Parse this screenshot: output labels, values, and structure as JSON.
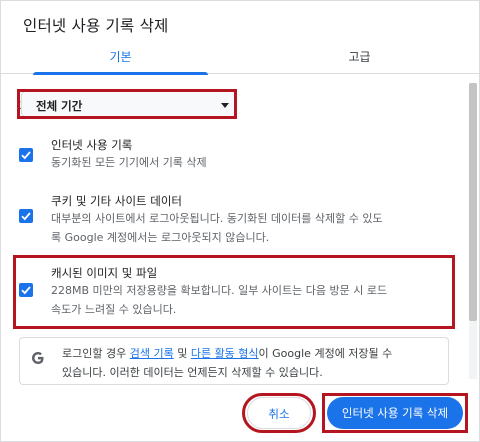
{
  "dialog": {
    "title": "인터넷 사용 기록 삭제"
  },
  "tabs": [
    {
      "label": "기본",
      "active": true
    },
    {
      "label": "고급",
      "active": false
    }
  ],
  "time_range": {
    "label": "기간",
    "selected": "전체 기간"
  },
  "items": [
    {
      "title": "인터넷 사용 기록",
      "line1": "동기화된 모든 기기에서 기록 삭제",
      "line2": "",
      "checked": true,
      "highlighted": false
    },
    {
      "title": "쿠키 및 기타 사이트 데이터",
      "line1": "대부분의 사이트에서 로그아웃됩니다. 동기화된 데이터를 삭제할 수 있도",
      "line2": "록 Google 계정에서는 로그아웃되지 않습니다.",
      "checked": true,
      "highlighted": false
    },
    {
      "title": "캐시된 이미지 및 파일",
      "line1": "228MB 미만의 저장용량을 확보합니다. 일부 사이트는 다음 방문 시 로드",
      "line2": "속도가 느려질 수 있습니다.",
      "checked": true,
      "highlighted": true
    }
  ],
  "info": {
    "part1": "로그인할 경우 ",
    "link1": "검색 기록",
    "part2": " 및 ",
    "link2": "다른 활동 형식",
    "part3": "이 Google 계정에 저장될 수",
    "line2": "있습니다. 이러한 데이터는 언제든지 삭제할 수 있습니다."
  },
  "buttons": {
    "cancel": "취소",
    "delete": "인터넷 사용 기록 삭제"
  },
  "colors": {
    "accent": "#1a73e8",
    "highlight": "#b5151e"
  },
  "icons": {
    "info": "google-g-icon",
    "check": "check-icon",
    "dropdown": "chevron-down-icon"
  }
}
